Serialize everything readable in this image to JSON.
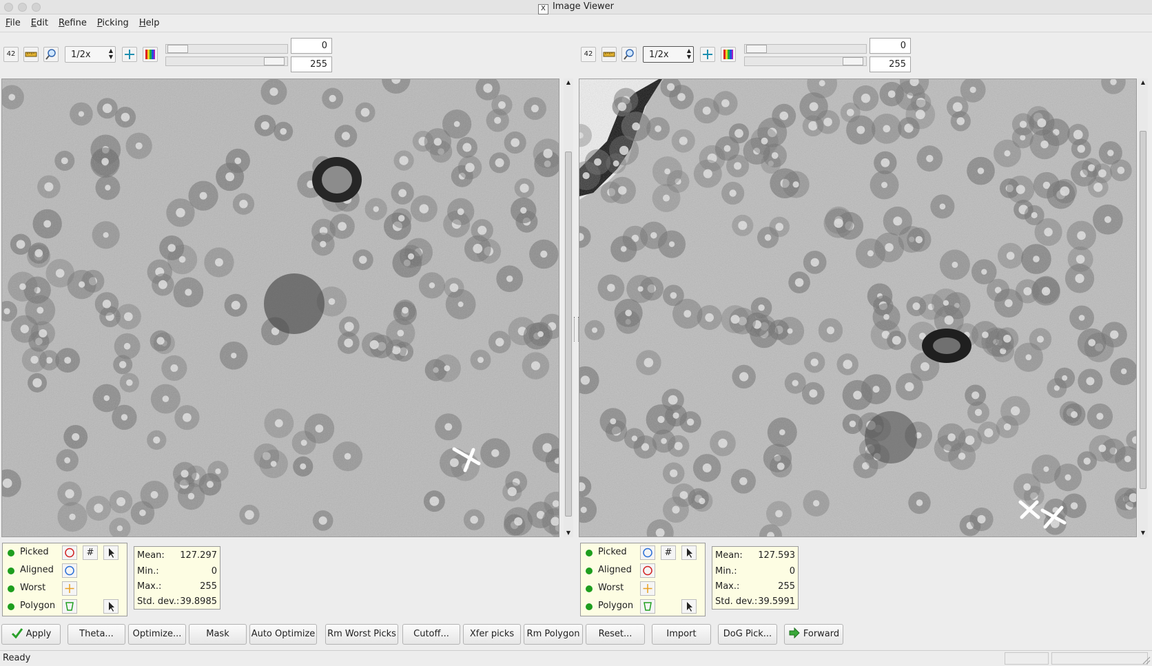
{
  "window": {
    "title": "Image Viewer"
  },
  "menu": [
    "File",
    "Edit",
    "Refine",
    "Picking",
    "Help"
  ],
  "left_panel": {
    "toolbar": {
      "id_label": "42",
      "zoom": "1/2x",
      "min_value": "0",
      "max_value": "255"
    },
    "legend": [
      {
        "label": "Picked",
        "symbol": "red-circle-icon"
      },
      {
        "label": "Aligned",
        "symbol": "blue-circle-icon"
      },
      {
        "label": "Worst",
        "symbol": "orange-cross-icon"
      },
      {
        "label": "Polygon",
        "symbol": "green-polygon-icon"
      }
    ],
    "hash_label": "#",
    "stats": {
      "mean_label": "Mean:",
      "mean": "127.297",
      "min_label": "Min.:",
      "min": "0",
      "max_label": "Max.:",
      "max": "255",
      "std_label": "Std. dev.:",
      "std": "39.8985"
    }
  },
  "right_panel": {
    "toolbar": {
      "id_label": "42",
      "zoom": "1/2x",
      "min_value": "0",
      "max_value": "255"
    },
    "legend": [
      {
        "label": "Picked",
        "symbol": "blue-circle-icon"
      },
      {
        "label": "Aligned",
        "symbol": "red-circle-icon"
      },
      {
        "label": "Worst",
        "symbol": "orange-cross-icon"
      },
      {
        "label": "Polygon",
        "symbol": "green-polygon-icon"
      }
    ],
    "hash_label": "#",
    "stats": {
      "mean_label": "Mean:",
      "mean": "127.593",
      "min_label": "Min.:",
      "min": "0",
      "max_label": "Max.:",
      "max": "255",
      "std_label": "Std. dev.:",
      "std": "39.5991"
    }
  },
  "buttons": [
    "Apply",
    "Theta...",
    "Optimize...",
    "Mask",
    "Auto Optimize",
    "Rm Worst Picks",
    "Cutoff...",
    "Xfer picks",
    "Rm Polygon",
    "Reset...",
    "Import",
    "DoG Pick...",
    "Forward"
  ],
  "status": {
    "text": "Ready"
  },
  "colors": {
    "legend_bg": "#fdfde3",
    "dot_green": "#1e9e1e",
    "picked_red": "#d22222",
    "aligned_blue": "#2a6fd6",
    "worst_orange": "#e8a020"
  }
}
